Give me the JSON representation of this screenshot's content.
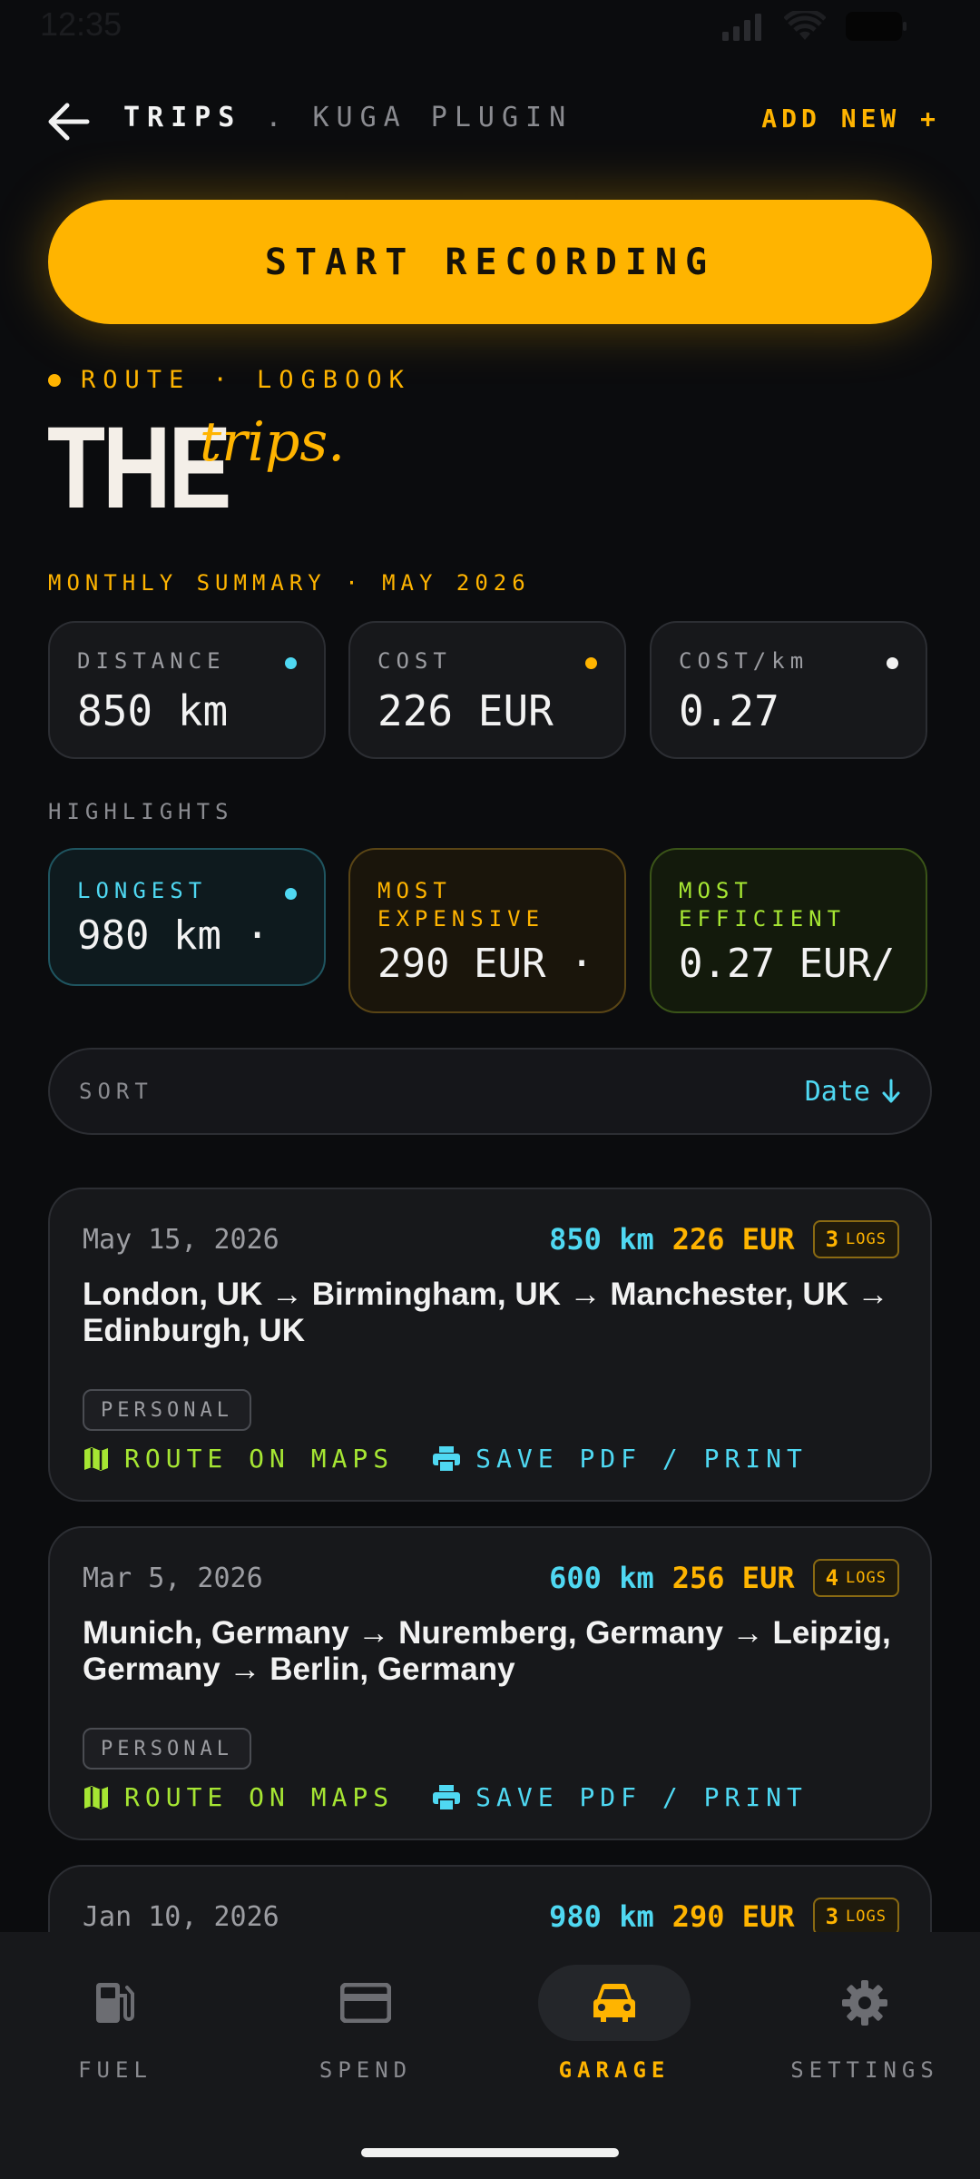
{
  "status": {
    "time": "12:35"
  },
  "header": {
    "title": "TRIPS",
    "separator": ".",
    "subtitle": "KUGA PLUGIN",
    "add_new": "ADD NEW +"
  },
  "start_button": {
    "label": "START RECORDING"
  },
  "eyebrow": {
    "text": "ROUTE · LOGBOOK"
  },
  "hero": {
    "big": "THE",
    "script": "trips."
  },
  "summary": {
    "label": "MONTHLY SUMMARY · MAY 2026",
    "cards": [
      {
        "label": "DISTANCE",
        "value": "850 km",
        "dot_color": "#4fd8f2"
      },
      {
        "label": "COST",
        "value": "226 EUR",
        "dot_color": "#ffb400"
      },
      {
        "label": "COST/km",
        "value": "0.27",
        "dot_color": "#f2f2f2"
      }
    ]
  },
  "highlights": {
    "label": "HIGHLIGHTS",
    "cards": [
      {
        "label": "LONGEST",
        "value": "980 km ·",
        "accent": "#4fd8f2"
      },
      {
        "label_line1": "MOST",
        "label_line2": "EXPENSIVE",
        "value": "290 EUR ·",
        "accent": "#ffb400"
      },
      {
        "label_line1": "MOST",
        "label_line2": "EFFICIENT",
        "value": "0.27 EUR/",
        "accent": "#a6e633"
      }
    ]
  },
  "sort": {
    "label": "SORT",
    "value": "Date"
  },
  "trips": [
    {
      "date": "May 15, 2026",
      "km": "850 km",
      "cost": "226 EUR",
      "logs_count": "3",
      "logs_word": "LOGS",
      "route": "London, UK → Birmingham, UK → Manchester, UK → Edinburgh, UK",
      "tag": "PERSONAL",
      "maps_label": "ROUTE ON MAPS",
      "pdf_label": "SAVE PDF / PRINT"
    },
    {
      "date": "Mar 5, 2026",
      "km": "600 km",
      "cost": "256 EUR",
      "logs_count": "4",
      "logs_word": "LOGS",
      "route": "Munich, Germany → Nuremberg, Germany → Leipzig, Germany → Berlin, Germany",
      "tag": "PERSONAL",
      "maps_label": "ROUTE ON MAPS",
      "pdf_label": "SAVE PDF / PRINT"
    },
    {
      "date": "Jan 10, 2026",
      "km": "980 km",
      "cost": "290 EUR",
      "logs_count": "3",
      "logs_word": "LOGS"
    }
  ],
  "nav": {
    "items": [
      {
        "label": "FUEL",
        "icon": "fuel-pump-icon"
      },
      {
        "label": "SPEND",
        "icon": "credit-card-icon"
      },
      {
        "label": "GARAGE",
        "icon": "car-icon",
        "active": true
      },
      {
        "label": "SETTINGS",
        "icon": "gear-icon"
      }
    ]
  },
  "colors": {
    "background": "#0b0c0e",
    "accent": "#ffb400",
    "cyan": "#4fd8f2",
    "green": "#a6e633"
  }
}
